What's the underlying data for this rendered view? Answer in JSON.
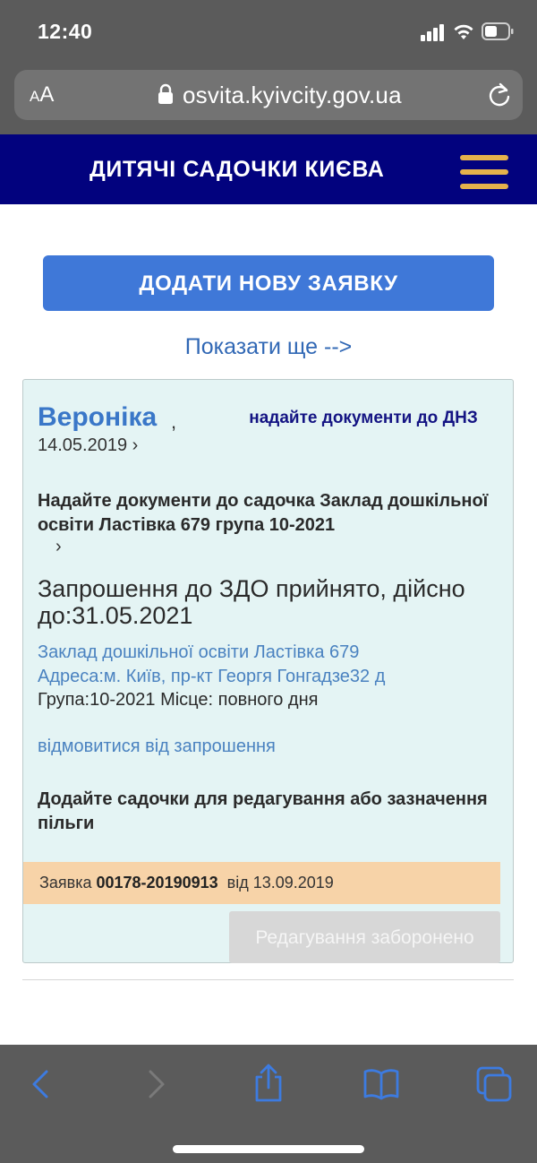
{
  "status_bar": {
    "time": "12:40"
  },
  "browser": {
    "aa_small": "A",
    "aa_large": "A",
    "url": "osvita.kyivcity.gov.ua"
  },
  "header": {
    "title": "ДИТЯЧІ САДОЧКИ КИЄВА"
  },
  "main": {
    "add_button": "ДОДАТИ НОВУ ЗАЯВКУ",
    "show_more": "Показати ще -->"
  },
  "card": {
    "child_name": "Вероніка",
    "comma": ",",
    "birth_date": "14.05.2019 ›",
    "status_note": "надайте документи до ДНЗ",
    "provide_docs": "Надайте документи до садочка Заклад дошкільної освіти Ластівка 679 група 10-2021",
    "provide_docs_arrow": "›",
    "invite_status": "Запрошення до ЗДО прийнято, дійсно до:31.05.2021",
    "school_name": "Заклад дошкільної освіти Ластівка 679",
    "school_address": "Адреса:м. Київ, пр-кт Георгя Гонгадзе32 д",
    "group_place": "Група:10-2021 Місце: повного дня",
    "decline_link": "відмовитися від запрошення",
    "add_kindergartens": "Додайте садочки для редагування або зазначення пільги",
    "request_prefix": "Заявка",
    "request_number": "00178-20190913",
    "request_suffix": "від 13.09.2019",
    "edit_button": "Редагування заборонено"
  },
  "colors": {
    "header_bg": "#02027e",
    "accent_blue": "#3f78d8",
    "link_blue": "#4a82c0",
    "card_bg": "#e4f4f4",
    "request_bar_bg": "#f7d3a8",
    "menu_icon": "#e5b24c",
    "safari_chrome": "#5b5b5b",
    "safari_icon": "#3d7be0"
  },
  "icons": {
    "signal": "cellular-signal-icon",
    "wifi": "wifi-icon",
    "battery": "battery-icon",
    "lock": "lock-icon",
    "reload": "reload-icon",
    "menu": "hamburger-menu-icon",
    "back": "back-arrow-icon",
    "forward": "forward-arrow-icon",
    "share": "share-icon",
    "bookmarks": "bookmarks-book-icon",
    "tabs": "tabs-icon"
  }
}
